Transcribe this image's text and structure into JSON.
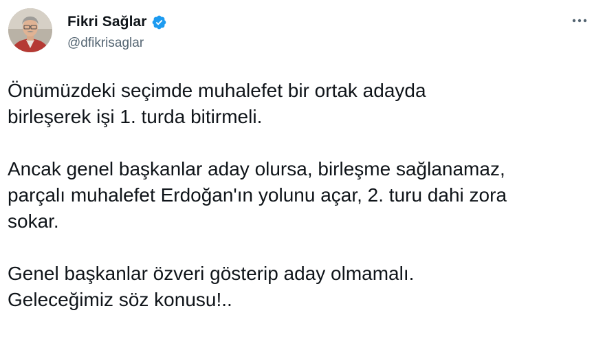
{
  "author": {
    "display_name": "Fikri Sağlar",
    "handle": "@dfikrisaglar",
    "verified": true
  },
  "icons": {
    "verified": "verified-badge-icon",
    "more": "more-horizontal-icon"
  },
  "colors": {
    "verified_badge": "#1d9bf0",
    "text_primary": "#0f1419",
    "text_secondary": "#536471"
  },
  "tweet": {
    "paragraphs": [
      "Önümüzdeki seçimde muhalefet bir ortak adayda\nbirleşerek işi 1. turda bitirmeli.",
      "Ancak genel başkanlar aday olursa, birleşme sağlanamaz,\nparçalı muhalefet Erdoğan'ın yolunu açar, 2. turu dahi zora\nsokar.",
      "Genel başkanlar özveri gösterip aday olmamalı.\nGeleceğimiz söz konusu!.."
    ]
  }
}
